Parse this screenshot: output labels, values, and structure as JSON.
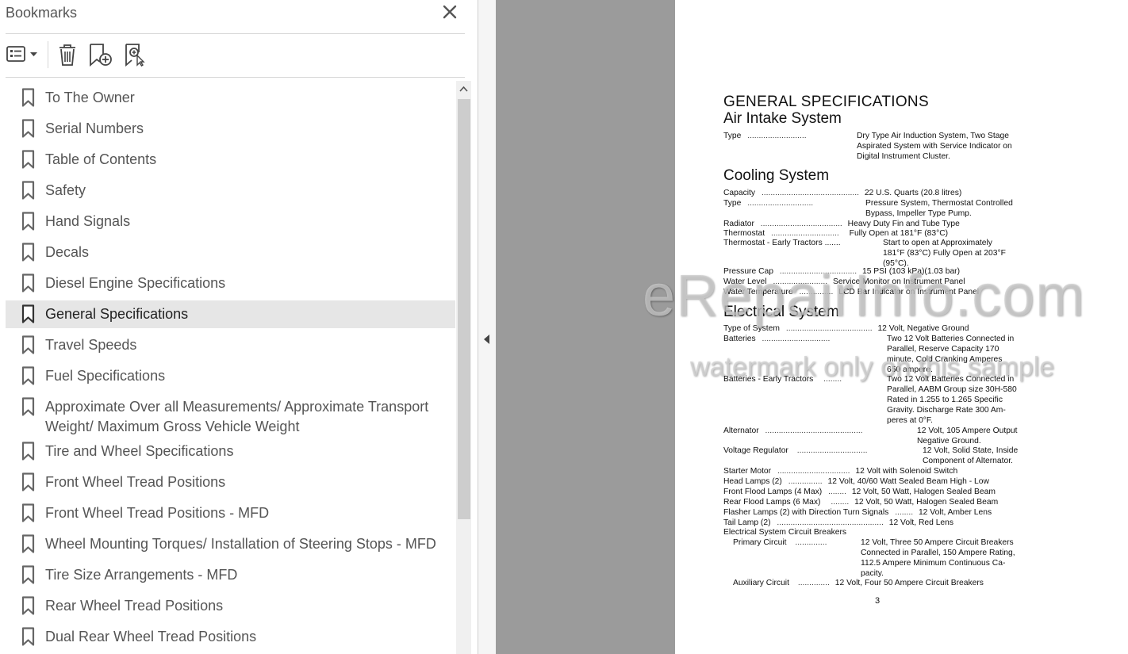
{
  "panel": {
    "title": "Bookmarks"
  },
  "bookmarks": [
    {
      "label": "To The Owner"
    },
    {
      "label": "Serial Numbers"
    },
    {
      "label": "Table of Contents"
    },
    {
      "label": "Safety"
    },
    {
      "label": "Hand Signals"
    },
    {
      "label": "Decals"
    },
    {
      "label": "Diesel Engine Specifications"
    },
    {
      "label": "General Specifications",
      "selected": true
    },
    {
      "label": "Travel Speeds"
    },
    {
      "label": "Fuel Specifications"
    },
    {
      "label": "Approximate Over all Measurements/ Approximate Transport",
      "label2": "Weight/ Maximum Gross Vehicle Weight"
    },
    {
      "label": "Tire and Wheel Specifications"
    },
    {
      "label": "Front Wheel Tread Positions"
    },
    {
      "label": "Front Wheel Tread Positions  - MFD"
    },
    {
      "label": "Wheel Mounting Torques/ Installation of Steering Stops - MFD"
    },
    {
      "label": "Tire Size Arrangements - MFD"
    },
    {
      "label": "Rear Wheel Tread Positions"
    },
    {
      "label": "Dual Rear Wheel Tread Positions"
    }
  ],
  "doc": {
    "title": "GENERAL SPECIFICATIONS",
    "air": {
      "heading": "Air Intake System",
      "type_label": "Type",
      "type_dots": "..........................",
      "type_value": [
        "Dry Type Air Induction System, Two Stage",
        "Aspirated System with Service Indicator on",
        "Digital Instrument Cluster."
      ]
    },
    "cooling": {
      "heading": "Cooling System",
      "capacity_label": "Capacity",
      "capacity_dots": "...........................................",
      "capacity_value": "22 U.S. Quarts (20.8 litres)",
      "type_label": "Type",
      "type_dots": ".............................",
      "type_value": [
        "Pressure System, Thermostat Controlled",
        "Bypass, Impeller Type Pump."
      ],
      "radiator_label": "Radiator",
      "radiator_dots": "....................................",
      "radiator_value": "Heavy Duty Fin and Tube Type",
      "thermostat_label": "Thermostat",
      "thermostat_dots": "..............................",
      "thermostat_value": "Fully Open at 181°F (83°C)",
      "thermo_early_label": "Thermostat - Early Tractors .......",
      "thermo_early_value": [
        "Start  to  open  at  Approximately",
        "181°F (83°C) Fully Open at 203°F",
        "(95°C)."
      ],
      "pressure_label": "Pressure Cap",
      "pressure_dots": "..................................",
      "pressure_value": "15 PSI (103 kPa)(1.03 bar)",
      "water_level_label": "Water Level",
      "water_level_dots": "........................",
      "water_level_value": "Service Monitor on Instrument Panel",
      "water_temp_label": "Water Temperature",
      "water_temp_dots": "...............",
      "water_temp_value": "LCD Bar Indicator on Instrument Panel"
    },
    "electrical": {
      "heading": "Electrical System",
      "sys_label": "Type of System",
      "sys_dots": "......................................",
      "sys_value": "12 Volt, Negative Ground",
      "batt_label": "Batteries",
      "batt_dots": "..............................",
      "batt_value": [
        "Two 12 Volt Batteries Connected in",
        "Parallel,  Reserve  Capacity  170",
        "minute,  Cold  Cranking  Amperes",
        "650 ampere."
      ],
      "batt_early_label": "Batteries - Early Tractors",
      "batt_early_dots": "........",
      "batt_early_value": [
        "Two 12 Volt Batteries Connected in",
        "Parallel, AABM Group size 30H-580",
        "Rated  in  1.255  to  1.265  Specific",
        "Gravity.  Discharge  Rate  300  Am-",
        "peres at 0°F."
      ],
      "alt_label": "Alternator",
      "alt_dots": "...........................................",
      "alt_value": [
        "12 Volt, 105 Ampere Output",
        "Negative Ground."
      ],
      "vreg_label": "Voltage Regulator",
      "vreg_dots": "...............................",
      "vreg_value": [
        "12 Volt, Solid State, Inside",
        "Component of Alternator."
      ],
      "starter_label": "Starter Motor",
      "starter_dots": "................................",
      "starter_value": "12 Volt with Solenoid Switch",
      "head_label": "Head Lamps (2)",
      "head_dots": "...............",
      "head_value": "12 Volt, 40/60 Watt Sealed Beam High - Low",
      "front_label": "Front Flood Lamps (4 Max)",
      "front_dots": "........",
      "front_value": "12 Volt, 50 Watt, Halogen Sealed Beam",
      "rear_label": "Rear Flood Lamps (6 Max)",
      "rear_dots": "........",
      "rear_value": "12 Volt, 50 Watt, Halogen Sealed Beam",
      "flasher_label": "Flasher Lamps (2) with Direction Turn Signals",
      "flasher_dots": "........",
      "flasher_value": "12 Volt, Amber Lens",
      "tail_label": "Tail Lamp  (2)",
      "tail_dots": "...............................................",
      "tail_value": "12 Volt, Red Lens",
      "breakers_label": "Electrical System Circuit Breakers",
      "primary_label": "Primary Circuit",
      "primary_dots": "..............",
      "primary_value": [
        "12 Volt, Three 50 Ampere Circuit Breakers",
        "Connected in Parallel, 150 Ampere Rating,",
        "112.5  Ampere  Minimum  Continuous  Ca-",
        "pacity."
      ],
      "aux_label": "Auxiliary Circuit",
      "aux_dots": "..............",
      "aux_value": "12 Volt, Four 50 Ampere Circuit Breakers"
    },
    "page_number": "3",
    "watermark_main": "eRepairInfo.com",
    "watermark_sub": "watermark only on this sample"
  },
  "colors": {
    "selected_bg": "#e6e6e6",
    "viewer_bg": "#9b9b9b"
  },
  "icons": [
    "close-icon",
    "options-menu-icon",
    "delete-icon",
    "new-bookmark-icon",
    "find-bookmark-icon",
    "bookmark-icon",
    "scroll-up-icon",
    "collapse-panel-icon"
  ]
}
